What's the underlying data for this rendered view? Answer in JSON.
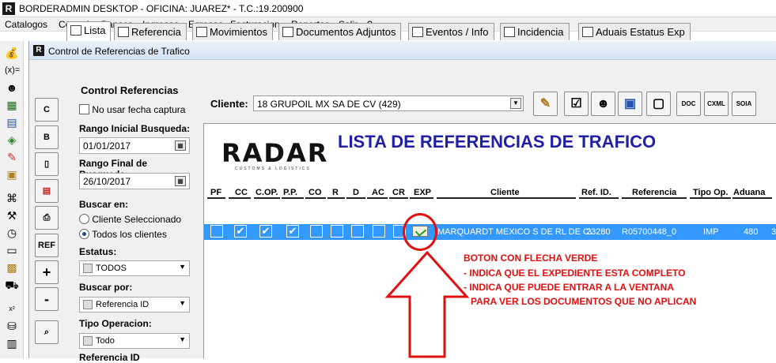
{
  "window": {
    "title": "BORDERADMIN DESKTOP - OFICINA: JUAREZ* -  T.C.:19.200900"
  },
  "menu": [
    "Catalogos",
    "Control",
    "Bancos",
    "Ingresos",
    "Egresos",
    "Facturacion",
    "Reportes",
    "Salir",
    "?"
  ],
  "inner_window": {
    "title": "Control de Referencias de Trafico"
  },
  "tabs": [
    "Lista",
    "Referencia",
    "Movimientos",
    "Documentos Adjuntos",
    "Eventos / Info",
    "Incidencia",
    "Aduais Estatus Exp"
  ],
  "side_buttons": [
    "C",
    "B",
    "",
    "",
    "",
    "REF",
    "+",
    "-",
    ""
  ],
  "panel": {
    "title": "Control Referencias",
    "no_date_label": "No usar fecha captura",
    "start_label": "Rango Inicial Busqueda:",
    "start_value": "01/01/2017",
    "end_label": "Rango Final de Busqueda:",
    "end_value": "26/10/2017",
    "search_in_label": "Buscar en:",
    "radio_selected_client": "Cliente Seleccionado",
    "radio_all_clients": "Todos los clientes",
    "status_label": "Estatus:",
    "status_value": "TODOS",
    "search_by_label": "Buscar por:",
    "search_by_value": "Referencia ID",
    "op_type_label": "Tipo Operacion:",
    "op_type_value": "Todo",
    "ref_id_label": "Referencia ID"
  },
  "client": {
    "label": "Cliente:",
    "value": "18 GRUPOIL MX SA DE CV (429)"
  },
  "toolbar_buttons": [
    "DOC",
    "CXML",
    "SOIA"
  ],
  "grid": {
    "logo": "RADAR",
    "logo_sub": "CUSTOMS & LOGISTICS",
    "heading": "LISTA DE REFERENCIAS DE TRAFICO",
    "columns": [
      "PF",
      "CC",
      "C.OP.",
      "P.P.",
      "CO",
      "R",
      "D",
      "AC",
      "CR",
      "EXP",
      "Cliente",
      "Ref. ID.",
      "Referencia",
      "Tipo Op.",
      "Aduana"
    ],
    "row": {
      "cliente": "MARQUARDT MEXICO S DE RL DE C\\",
      "ref_id": "23280",
      "referencia": "R05700448_0",
      "tipo_op": "IMP",
      "aduana": "480",
      "extra": "3"
    }
  },
  "annotation": {
    "line1": "BOTON CON FLECHA VERDE",
    "line2": "- INDICA QUE EL EXPEDIENTE ESTA COMPLETO",
    "line3": "- INDICA QUE PUEDE ENTRAR A LA VENTANA",
    "line4": "PARA VER LOS DOCUMENTOS QUE NO APLICAN"
  },
  "colors": {
    "selection": "#3399ff",
    "heading": "#1f1fa8",
    "annotation": "#e01010"
  }
}
